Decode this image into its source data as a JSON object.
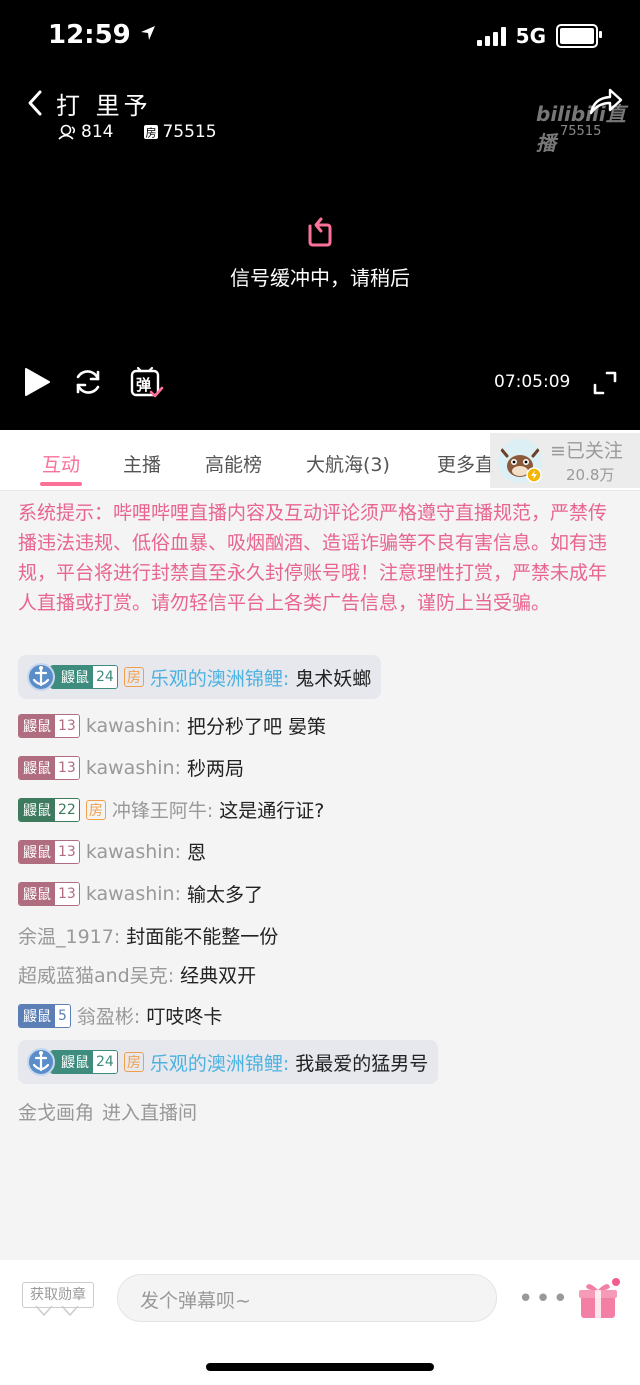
{
  "status_bar": {
    "time": "12:59",
    "network": "5G"
  },
  "header": {
    "title": "打 里予",
    "viewers": "814",
    "room_id": "75515",
    "logo_text": "bilibili直播",
    "room_mini": "75515"
  },
  "player": {
    "buffer_text": "信号缓冲中，请稍后",
    "danmaku_label": "弹",
    "time": "07:05:09"
  },
  "tabs": [
    {
      "label": "互动",
      "active": true
    },
    {
      "label": "主播"
    },
    {
      "label": "高能榜"
    },
    {
      "label": "大航海(3)"
    },
    {
      "label": "更多直"
    }
  ],
  "follow": {
    "label": "≡已关注",
    "count": "20.8万"
  },
  "system_message": "系统提示：哔哩哔哩直播内容及互动评论须严格遵守直播规范，严禁传播违法违规、低俗血暴、吸烟酗酒、造谣诈骗等不良有害信息。如有违规，平台将进行封禁直至永久封停账号哦！注意理性打赏，严禁未成年人直播或打赏。请勿轻信平台上各类广告信息，谨防上当受骗。",
  "messages": [
    {
      "medal": "鼹鼠",
      "level": "24",
      "room_tag": "房",
      "user": "乐观的澳洲锦鲤:",
      "text": "鬼术妖螂"
    },
    {
      "medal": "鼹鼠",
      "level": "13",
      "user": "kawashin:",
      "text": "把分秒了吧 晏策"
    },
    {
      "medal": "鼹鼠",
      "level": "13",
      "user": "kawashin:",
      "text": "秒两局"
    },
    {
      "medal": "鼹鼠",
      "level": "22",
      "room_tag": "房",
      "user": "冲锋王阿牛:",
      "text": "这是通行证?"
    },
    {
      "medal": "鼹鼠",
      "level": "13",
      "user": "kawashin:",
      "text": "恩"
    },
    {
      "medal": "鼹鼠",
      "level": "13",
      "user": "kawashin:",
      "text": "输太多了"
    },
    {
      "user": "余温_1917:",
      "text": "封面能不能整一份"
    },
    {
      "user": "超威蓝猫and吴克:",
      "text": "经典双开"
    },
    {
      "medal": "鼹鼠",
      "level": "5",
      "user": "翁盈彬:",
      "text": "叮吱咚卡"
    },
    {
      "medal": "鼹鼠",
      "level": "24",
      "room_tag": "房",
      "user": "乐观的澳洲锦鲤:",
      "text": "我最爱的猛男号"
    },
    {
      "user": "金戈画角",
      "text": "进入直播间"
    }
  ],
  "bottom": {
    "medal_button": "获取勋章",
    "input_placeholder": "发个弹幕呗~",
    "more": "•••"
  },
  "colors": {
    "accent": "#fb7299",
    "system_text": "#e8658f",
    "guard_name": "#4db2e0"
  }
}
